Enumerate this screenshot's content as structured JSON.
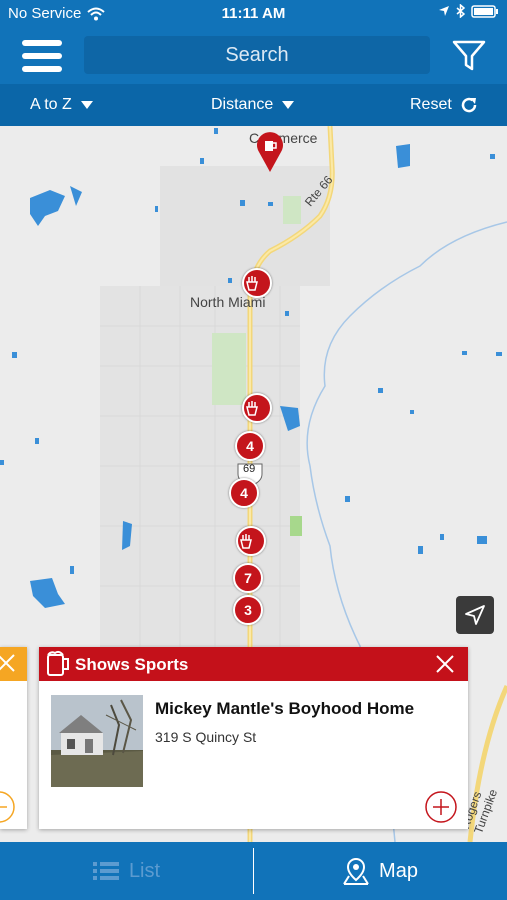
{
  "status_bar": {
    "carrier": "No Service",
    "time": "11:11 AM"
  },
  "top_bar": {
    "search_placeholder": "Search"
  },
  "filter_bar": {
    "sort_label": "A to Z",
    "distance_label": "Distance",
    "reset_label": "Reset"
  },
  "map": {
    "place_labels": [
      "Commerce",
      "North Miami"
    ],
    "road_labels": [
      "Rte 66",
      "69",
      "Rogers Turnpike"
    ],
    "cluster_counts": [
      "4",
      "4",
      "7",
      "3"
    ]
  },
  "card": {
    "category": "Shows Sports",
    "name": "Mickey Mantle's Boyhood Home",
    "address": "319 S Quincy St"
  },
  "bottom_nav": {
    "list_label": "List",
    "map_label": "Map"
  },
  "colors": {
    "header_blue": "#1173b9",
    "marker_red": "#c4151c",
    "accent_orange": "#f5a623"
  }
}
